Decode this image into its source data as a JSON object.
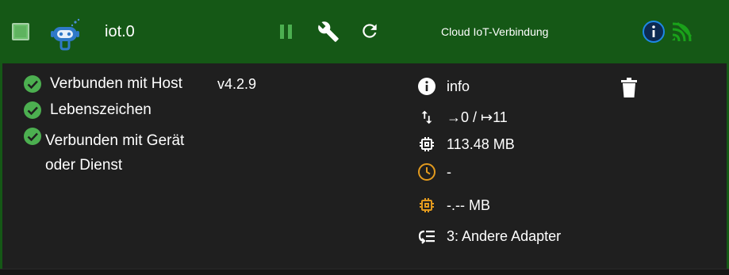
{
  "header": {
    "title": "iot.0",
    "description": "Cloud IoT-Verbindung",
    "colors": {
      "background": "#155816",
      "icon_green": "#4caf50",
      "info_blue": "#1e88e5",
      "signal_green": "#1aa11a"
    }
  },
  "status": {
    "items": [
      {
        "label": "Verbunden mit Host"
      },
      {
        "label": "Lebenszeichen"
      },
      {
        "label_line1": "Verbunden mit Gerät",
        "label_line2": "oder Dienst"
      }
    ],
    "version": "v4.2.9"
  },
  "info": {
    "label": "info",
    "events": "→0 / ↦11",
    "memory": "113.48 MB",
    "uptime": "-",
    "memory2": "-.-- MB",
    "instances": "3: Andere Adapter",
    "colors": {
      "orange": "#e29a1e"
    }
  }
}
